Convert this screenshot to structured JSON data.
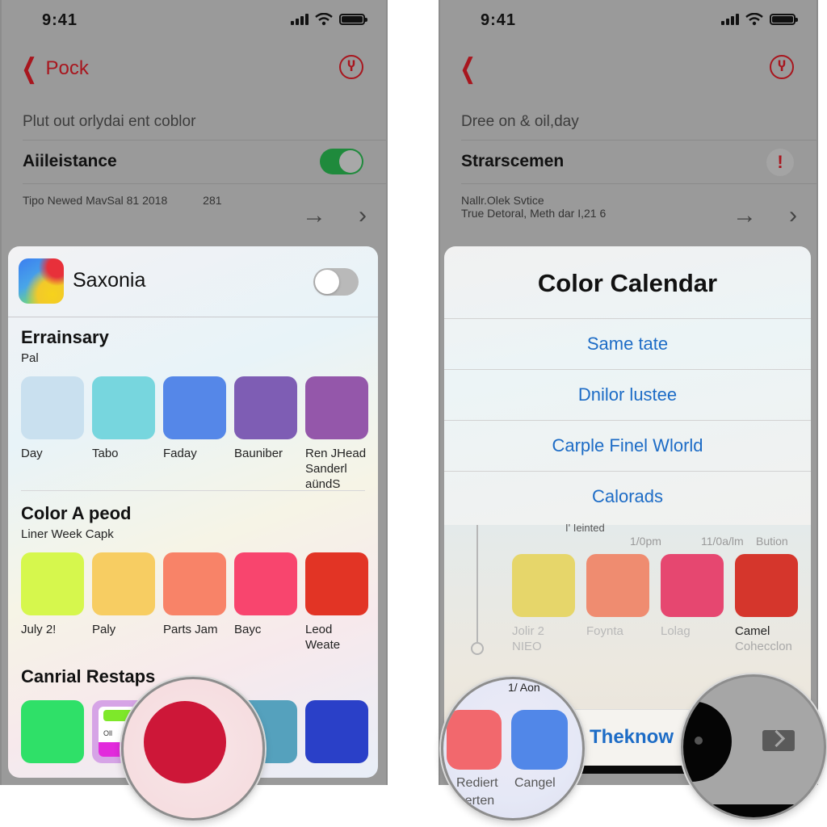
{
  "left_screen": {
    "status_time": "9:41",
    "nav": {
      "back_label": "Pock",
      "right_icon": "timer-icon"
    },
    "rows": {
      "sub_label": "Plut out orlydai ent coblor",
      "main_label": "Aiileistance",
      "main_toggle_on": true,
      "detail_text": "Tipo Newed MavSal 81 2018",
      "detail_count": "281"
    },
    "sheet": {
      "app_name": "Saxonia",
      "app_toggle_on": false,
      "sections": [
        {
          "title": "Errainsary",
          "subtitle": "Pal",
          "swatches": [
            {
              "label": "Day",
              "color": "#c9e0ef"
            },
            {
              "label": "Tabo",
              "color": "#77d6de"
            },
            {
              "label": "Faday",
              "color": "#5587e8"
            },
            {
              "label": "Bauniber",
              "color": "#7e5db4"
            },
            {
              "label": "Ren JHead Sanderl aündS",
              "color": "#9457aa"
            }
          ]
        },
        {
          "title": "Color A peod",
          "subtitle": "Liner Week Capk",
          "swatches": [
            {
              "label": "July 2!",
              "color": "#d6f74d"
            },
            {
              "label": "Paly",
              "color": "#f7cd62"
            },
            {
              "label": "Parts Jam",
              "color": "#f88368"
            },
            {
              "label": "Bayc",
              "color": "#f8456e"
            },
            {
              "label": "Leod Weate",
              "color": "#e23425"
            }
          ]
        },
        {
          "title": "Canrial Restaps",
          "swatches": [
            {
              "label": "",
              "color": "#2fe068"
            },
            {
              "label": "",
              "mini_label": "Oll",
              "color": "#d6a4e6"
            },
            {
              "label": "",
              "color": "#55a1bd"
            },
            {
              "label": "",
              "color": "#2a40c8"
            }
          ]
        }
      ],
      "magnified_color": "#cd1738"
    }
  },
  "right_screen": {
    "status_time": "9:41",
    "nav": {
      "right_icon": "timer-icon"
    },
    "rows": {
      "sub_label": "Dree on & oil,day",
      "main_label": "Strarscemen",
      "main_badge": "!",
      "detail_line1": "Nallr.Olek Svtice",
      "detail_line2": "True Detoral, Meth dar I,21 6"
    },
    "alert": {
      "title": "Color Calendar",
      "actions": [
        "Same tate",
        "Dnilor lustee",
        "Carple Finel Wlorld",
        "Calorads"
      ]
    },
    "lower": {
      "caption": "I' Ieinted",
      "times": [
        "1/0pm",
        "11/0a/lm",
        "Bution"
      ],
      "swatches": [
        {
          "label": "Jolir 2",
          "sub": "NIEO",
          "color": "#e6d66a"
        },
        {
          "label": "Foynta",
          "sub": "",
          "color": "#ef8c70"
        },
        {
          "label": "Lolag",
          "sub": "",
          "color": "#e64770"
        },
        {
          "label": "Camel",
          "sub": "Cohecclon",
          "color": "#d5362c"
        }
      ],
      "button_label": "Theknow"
    },
    "magnifier_left": {
      "caption": "1/ Aon",
      "labels": [
        "Rediert",
        "Cangel",
        "Aerten"
      ],
      "colors": [
        "#f2686d",
        "#5187e8"
      ]
    },
    "magnifier_right": {
      "icon": "forward-icon"
    }
  }
}
